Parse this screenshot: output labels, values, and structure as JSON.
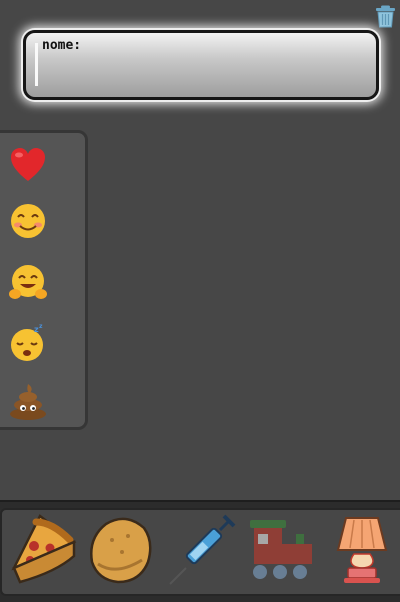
{
  "name_field": {
    "label": "nome:"
  },
  "icons": {
    "trash": "trash-icon",
    "emojis": [
      "heart",
      "smiling-face",
      "hugging-face",
      "sleeping-face",
      "pile-of-poo"
    ],
    "toys": [
      "pizza",
      "bread",
      "syringe",
      "toy-train",
      "lamp"
    ]
  }
}
